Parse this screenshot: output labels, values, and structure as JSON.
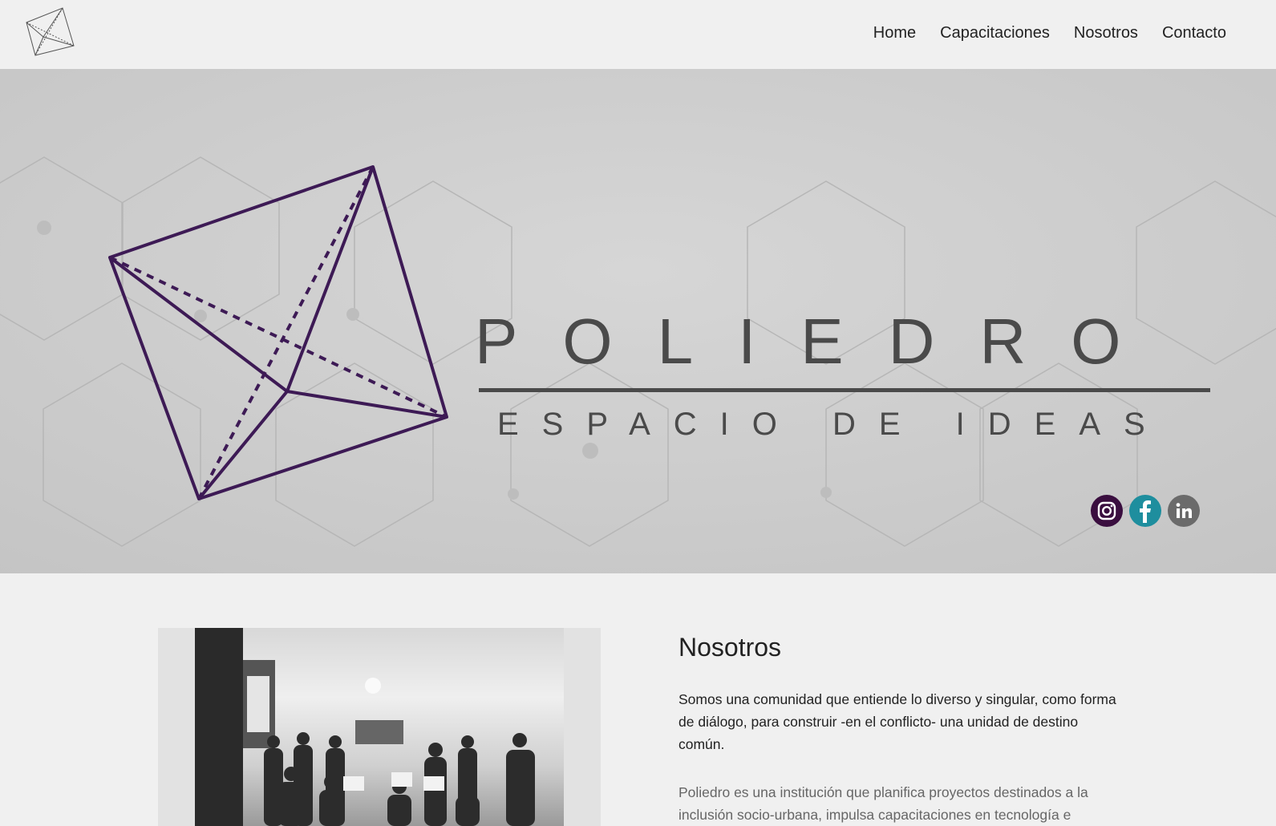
{
  "header": {
    "nav": [
      "Home",
      "Capacitaciones",
      "Nosotros",
      "Contacto"
    ]
  },
  "hero": {
    "title": "POLIEDRO",
    "tagline": "ESPACIO DE IDEAS",
    "logo_color": "#3d1a55",
    "social": [
      {
        "name": "instagram-icon",
        "color": "#3a0e3f"
      },
      {
        "name": "facebook-icon",
        "color": "#1e8e9e"
      },
      {
        "name": "linkedin-icon",
        "color": "#6b6b6b"
      }
    ]
  },
  "about": {
    "title": "Nosotros",
    "p1": "Somos una comunidad que entiende lo diverso y singular, como forma de diálogo, para construir -en el conflicto- una unidad de destino común.",
    "p2": "Poliedro es una institución que planifica proyectos destinados a la inclusión socio-urbana, impulsa capacitaciones en tecnología e"
  }
}
